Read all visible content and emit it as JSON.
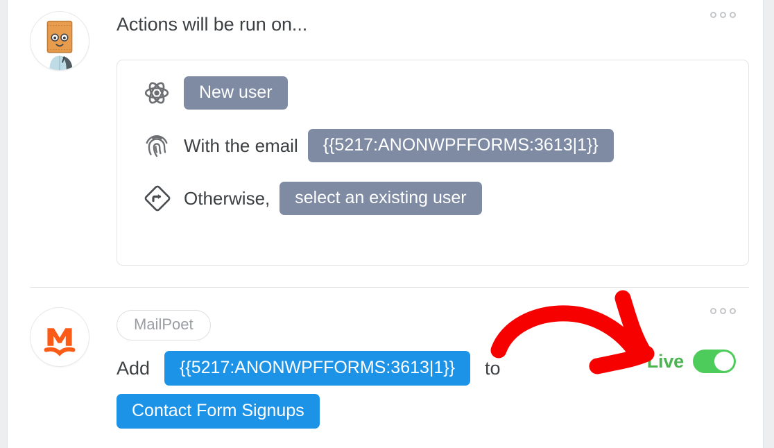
{
  "window": {
    "page_background": "#edeeef",
    "panel_background": "#ffffff"
  },
  "trigger_section": {
    "avatar_name": "paper-bag-character-avatar",
    "heading": "Actions will be run on...",
    "menu_label": "⋯",
    "card": {
      "rows": [
        {
          "icon": "atom-icon",
          "prefix_text": "",
          "pill_label": "New user",
          "pill_color": "#7e8ba3"
        },
        {
          "icon": "fingerprint-icon",
          "prefix_text": "With the email",
          "pill_label": "{{5217:ANONWPFFORMS:3613|1}}",
          "pill_color": "#7e8ba3"
        },
        {
          "icon": "road-sign-turn-right-icon",
          "prefix_text": "Otherwise,",
          "pill_label": "select an existing user",
          "pill_color": "#7e8ba3"
        }
      ]
    }
  },
  "action_section": {
    "avatar_name": "mailpoet-logo-avatar",
    "app_badge": "MailPoet",
    "menu_label": "⋯",
    "sentence": {
      "lead": "Add",
      "subject_pill": "{{5217:ANONWPFFORMS:3613|1}}",
      "connector": "to",
      "target_pill": "Contact Form Signups",
      "pill_color": "#1d93e8"
    },
    "status": {
      "label": "Live",
      "enabled": true,
      "color": "#4cb450",
      "track_color": "#4ecc5b"
    }
  },
  "annotation": {
    "type": "hand-drawn-curved-arrow",
    "color": "#f70000",
    "points_to": "Live"
  }
}
